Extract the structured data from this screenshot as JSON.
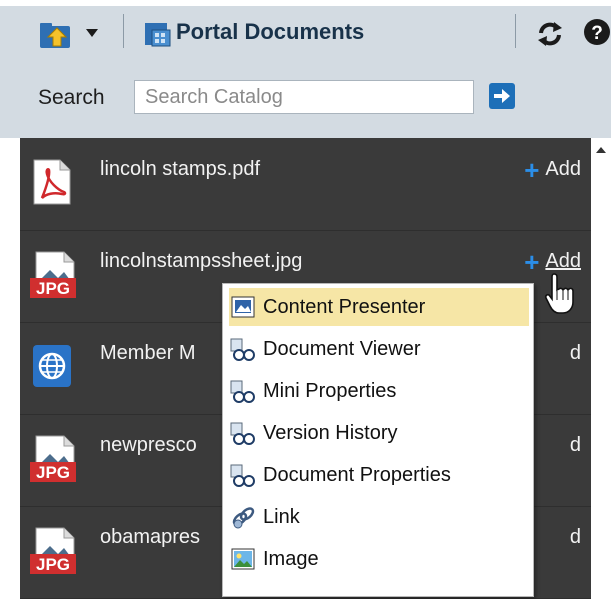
{
  "toolbar": {
    "title": "Portal Documents",
    "icons": [
      "folder-up-icon",
      "chevron-down-icon",
      "portal-documents-icon",
      "refresh-icon",
      "help-icon"
    ]
  },
  "search": {
    "label": "Search",
    "placeholder": "Search Catalog",
    "go_icon": "arrow-right-icon"
  },
  "files": [
    {
      "name": "lincoln stamps.pdf",
      "icon": "pdf-icon",
      "action": "Add"
    },
    {
      "name": "lincolnstampssheet.jpg",
      "icon": "jpg-icon",
      "action": "Add"
    },
    {
      "name": "Member M",
      "icon": "web-globe-icon",
      "action": "d"
    },
    {
      "name": "newpresco",
      "icon": "jpg-icon",
      "action": "d"
    },
    {
      "name": "obamapres",
      "icon": "jpg-icon",
      "action": "d"
    }
  ],
  "context_menu": {
    "items": [
      {
        "label": "Content Presenter",
        "icon": "content-presenter-icon",
        "highlighted": true
      },
      {
        "label": "Document Viewer",
        "icon": "task-flow-icon"
      },
      {
        "label": "Mini Properties",
        "icon": "task-flow-icon"
      },
      {
        "label": "Version History",
        "icon": "task-flow-icon"
      },
      {
        "label": "Document Properties",
        "icon": "task-flow-icon"
      },
      {
        "label": "Link",
        "icon": "link-icon"
      },
      {
        "label": "Image",
        "icon": "image-icon"
      }
    ]
  },
  "colors": {
    "toolbar_bg": "#d3dbe2",
    "list_bg": "#3a3a3a",
    "add_plus": "#2b8ee8",
    "menu_highlight": "#f6e6a6"
  }
}
